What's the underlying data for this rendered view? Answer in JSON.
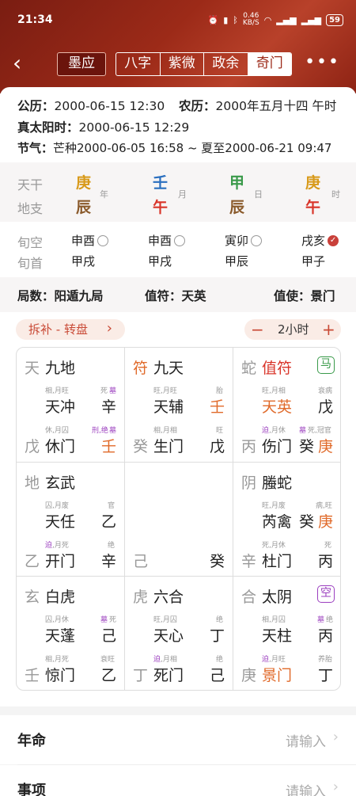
{
  "status_bar": {
    "time": "21:34",
    "speed": "0.46\nKB/S",
    "battery": "59"
  },
  "nav": {
    "back": "‹",
    "mo": "墨应",
    "tabs": [
      "八字",
      "紫微",
      "政余",
      "奇门"
    ],
    "more": "•••"
  },
  "info": {
    "gongli_label": "公历：",
    "gongli": "2000-06-15 12:30",
    "nongli_label": "农历：",
    "nongli": "2000年五月十四 午时",
    "zty_label": "真太阳时：",
    "zty": "2000-06-15 12:29",
    "jieqi_label": "节气：",
    "jieqi": "芒种2000-06-05 16:58 ~ 夏至2000-06-21 09:47"
  },
  "pillars": {
    "tiangan_label": "天干",
    "dizhi_label": "地支",
    "cols": [
      {
        "gan": "庚",
        "zhi": "辰",
        "pos": "年"
      },
      {
        "gan": "壬",
        "zhi": "午",
        "pos": "月"
      },
      {
        "gan": "甲",
        "zhi": "辰",
        "pos": "日"
      },
      {
        "gan": "庚",
        "zhi": "午",
        "pos": "时"
      }
    ],
    "xunkong_label": "旬空",
    "xunshou_label": "旬首",
    "xunkong": [
      "申酉",
      "申酉",
      "寅卯",
      "戌亥"
    ],
    "xunshou": [
      "甲戌",
      "甲戌",
      "甲辰",
      "甲子"
    ]
  },
  "ju": {
    "jushu": "局数：阳遁九局",
    "zhifu": "值符：天英",
    "zhishi": "值使：景门"
  },
  "controls": {
    "chaibu": "拆补 - 转盘",
    "chev": "›",
    "minus": "−",
    "interval": "2小时",
    "plus": "+"
  },
  "palaces": [
    {
      "shen": "天",
      "shen_name": "九地",
      "badge": "",
      "xing_state": "相,月旺",
      "xing_right_state": "死",
      "xing_right_state2": "墓",
      "xing": "天冲",
      "xing_gan": "辛",
      "men_state": "休,月囚",
      "men_right_state": "刑,绝",
      "men_right_state2": "墓",
      "di": "戊",
      "men": "休门",
      "men_gan": "壬"
    },
    {
      "shen": "符",
      "shen_name": "九天",
      "badge": "",
      "xing_state": "旺,月旺",
      "xing_right_state": "胎",
      "xing_right_state2": "",
      "xing": "天辅",
      "xing_gan": "壬",
      "men_state": "相,月相",
      "men_right_state": "旺",
      "men_right_state2": "",
      "di": "癸",
      "men": "生门",
      "men_gan": "戊"
    },
    {
      "shen": "蛇",
      "shen_name": "值符",
      "badge": "马",
      "xing_state": "旺,月相",
      "xing_right_state": "衰病",
      "xing_right_state2": "",
      "xing": "天英",
      "xing_gan": "戊",
      "men_state1": "迫",
      "men_state": ",月休",
      "men_right_state2": "墓",
      "men_right_state": "死,冠官",
      "di": "丙",
      "men": "伤门",
      "men_gan": "癸",
      "men_gan2": "庚"
    },
    {
      "shen": "地",
      "shen_name": "玄武",
      "badge": "",
      "xing_state": "囚,月废",
      "xing_right_state": "官",
      "xing_right_state2": "",
      "xing": "天任",
      "xing_gan": "乙",
      "men_state1": "迫",
      "men_state": ",月死",
      "men_right_state": "绝",
      "men_right_state2": "",
      "di": "乙",
      "men": "开门",
      "men_gan": "辛"
    },
    {
      "shen": "",
      "shen_name": "",
      "badge": "",
      "xing_state": "",
      "xing_right_state": "",
      "xing_right_state2": "",
      "xing": "",
      "xing_gan": "",
      "men_state": "",
      "men_right_state": "",
      "men_right_state2": "",
      "di": "己",
      "men": "",
      "men_gan": "癸"
    },
    {
      "shen": "阴",
      "shen_name": "螣蛇",
      "badge": "",
      "xing_state": "旺,月废",
      "xing_right_state": "病,旺",
      "xing_right_state2": "",
      "xing": "芮禽",
      "xing_gan": "癸",
      "xing_gan2": "庚",
      "men_state": "死,月休",
      "men_right_state": "死",
      "men_right_state2": "",
      "di": "辛",
      "men": "杜门",
      "men_gan": "丙"
    },
    {
      "shen": "玄",
      "shen_name": "白虎",
      "badge": "",
      "xing_state": "囚,月休",
      "xing_right_state": "死",
      "xing_right_state2": "墓",
      "xing": "天蓬",
      "xing_gan": "己",
      "men_state": "相,月死",
      "men_right_state": "衰旺",
      "men_right_state2": "",
      "di": "壬",
      "men": "惊门",
      "men_gan": "乙"
    },
    {
      "shen": "虎",
      "shen_name": "六合",
      "badge": "",
      "xing_state": "旺,月囚",
      "xing_right_state": "绝",
      "xing_right_state2": "",
      "xing": "天心",
      "xing_gan": "丁",
      "men_state1": "迫",
      "men_state": ",月相",
      "men_right_state": "绝",
      "men_right_state2": "",
      "di": "丁",
      "men": "死门",
      "men_gan": "己"
    },
    {
      "shen": "合",
      "shen_name": "太阴",
      "badge": "空",
      "xing_state": "相,月囚",
      "xing_right_state": "绝",
      "xing_right_state2": "墓",
      "xing": "天柱",
      "xing_gan": "丙",
      "men_state1": "迫",
      "men_state": ",月旺",
      "men_right_state": "养胎",
      "men_right_state2": "",
      "di": "庚",
      "men": "景门",
      "men_gan": "丁"
    }
  ],
  "rows": [
    {
      "label": "年命",
      "placeholder": "请输入"
    },
    {
      "label": "事项",
      "placeholder": "请输入"
    }
  ],
  "colors": {
    "header": "#9c2a18",
    "red": "#d9352a",
    "orange": "#e06a2a",
    "purple": "#9b3fbf",
    "green": "#3a9a4a",
    "blue": "#2a6fbf",
    "wood": "#8a5a2b",
    "metal": "#d89a1a"
  }
}
